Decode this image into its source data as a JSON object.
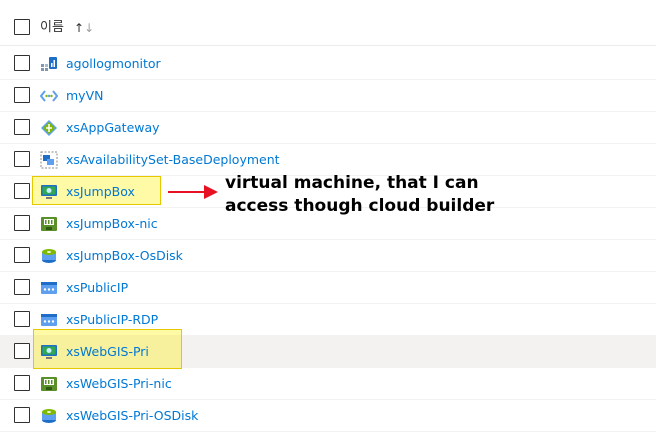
{
  "header": {
    "column_label": "이름",
    "sort_up": "↑",
    "sort_down": "↓"
  },
  "rows": [
    {
      "name": "agollogmonitor",
      "icon": "log-analytics-icon"
    },
    {
      "name": "myVN",
      "icon": "virtual-network-icon"
    },
    {
      "name": "xsAppGateway",
      "icon": "application-gateway-icon"
    },
    {
      "name": "xsAvailabilitySet-BaseDeployment",
      "icon": "availability-set-icon"
    },
    {
      "name": "xsJumpBox",
      "icon": "virtual-machine-icon"
    },
    {
      "name": "xsJumpBox-nic",
      "icon": "network-interface-icon"
    },
    {
      "name": "xsJumpBox-OsDisk",
      "icon": "disk-icon"
    },
    {
      "name": "xsPublicIP",
      "icon": "public-ip-icon"
    },
    {
      "name": "xsPublicIP-RDP",
      "icon": "public-ip-icon"
    },
    {
      "name": "xsWebGIS-Pri",
      "icon": "virtual-machine-icon"
    },
    {
      "name": "xsWebGIS-Pri-nic",
      "icon": "network-interface-icon"
    },
    {
      "name": "xsWebGIS-Pri-OSDisk",
      "icon": "disk-icon"
    }
  ],
  "annotation": {
    "line1": "virtual machine, that I can",
    "line2": "access though cloud builder",
    "arrow_color": "#e81123",
    "highlight_color": "#fff200"
  },
  "colors": {
    "link": "#0078d4",
    "selected_row": "#f3f2f1"
  }
}
